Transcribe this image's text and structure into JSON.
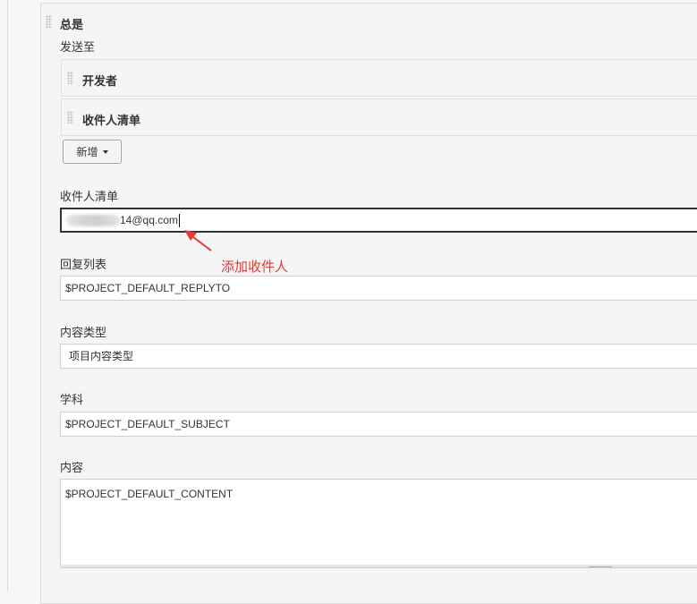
{
  "section": {
    "title": "总是",
    "send_to_label": "发送至"
  },
  "recipient_types": [
    {
      "label": "开发者"
    },
    {
      "label": "收件人清单"
    }
  ],
  "add_button": {
    "label": "新增"
  },
  "recipient_list": {
    "label": "收件人清单",
    "value_visible_suffix": "14@qq.com"
  },
  "annotation": {
    "text": "添加收件人",
    "color": "#e53935"
  },
  "reply_to": {
    "label": "回复列表",
    "value": "$PROJECT_DEFAULT_REPLYTO"
  },
  "content_type": {
    "label": "内容类型",
    "value": "项目内容类型"
  },
  "subject": {
    "label": "学科",
    "value": "$PROJECT_DEFAULT_SUBJECT"
  },
  "content": {
    "label": "内容",
    "value": "$PROJECT_DEFAULT_CONTENT"
  }
}
